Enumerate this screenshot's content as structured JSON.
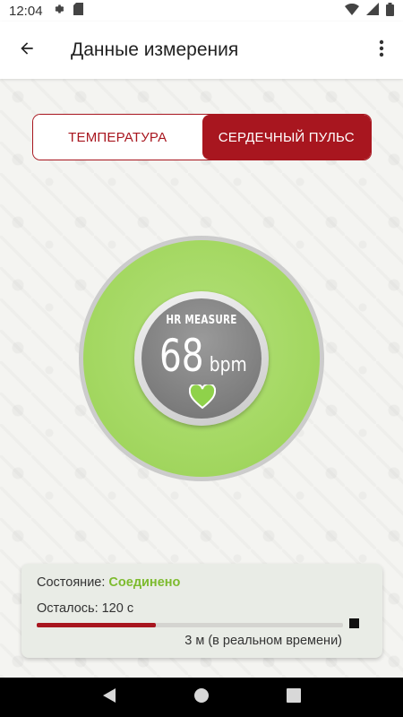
{
  "status_bar": {
    "time": "12:04",
    "icons": [
      "gear-icon",
      "sd-card-icon",
      "wifi-icon",
      "signal-icon",
      "battery-icon"
    ]
  },
  "app_bar": {
    "title": "Данные измерения",
    "back_icon": "arrow-left-icon",
    "menu_icon": "more-vert-icon"
  },
  "tabs": [
    {
      "label": "ТЕМПЕРАТУРА",
      "active": false
    },
    {
      "label": "СЕРДЕЧНЫЙ ПУЛЬС",
      "active": true
    }
  ],
  "gauge": {
    "label": "HR MEASURE",
    "value": "68",
    "unit": "bpm",
    "icon": "heart-icon"
  },
  "info_card": {
    "status_label": "Состояние:",
    "status_value": "Соединено",
    "remaining": "Осталось: 120 с",
    "progress_fraction": 0.39,
    "duration": "3 м (в реальном времени)",
    "stop_icon": "stop-icon"
  },
  "colors": {
    "accent": "#a8161f",
    "gauge_green": "#a4d862",
    "status_green": "#7dbb2e"
  },
  "nav_bar": {
    "icons": [
      "back-triangle-icon",
      "home-circle-icon",
      "recents-square-icon"
    ]
  }
}
